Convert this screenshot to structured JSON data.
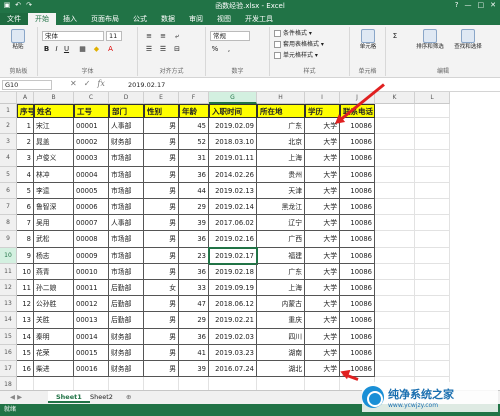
{
  "titlebar": {
    "title": "函数经验.xlsx - Excel",
    "qa_icons": [
      "save-icon",
      "undo-icon",
      "redo-icon"
    ],
    "window_controls": [
      "?",
      "—",
      "□",
      "✕"
    ]
  },
  "ribbon_tabs": [
    "文件",
    "开始",
    "插入",
    "页面布局",
    "公式",
    "数据",
    "审阅",
    "视图",
    "开发工具"
  ],
  "ribbon": {
    "clipboard": {
      "label": "剪贴板",
      "paste": "粘贴"
    },
    "font": {
      "label": "字体",
      "family": "宋体",
      "size": "11",
      "bold": "B",
      "italic": "I",
      "underline": "U"
    },
    "align": {
      "label": "对齐方式"
    },
    "number": {
      "label": "数字",
      "format": "常规",
      "percent": "%"
    },
    "styles": {
      "label": "样式",
      "items": [
        "条件格式 ▾",
        "套用表格格式 ▾",
        "单元格样式 ▾"
      ]
    },
    "cells": {
      "label": "单元格",
      "btn": "单元格"
    },
    "editing": {
      "label": "编辑",
      "sort": "排序和筛选",
      "find": "查找和选择"
    }
  },
  "formula_bar": {
    "name_box": "G10",
    "content": "2019.02.17"
  },
  "columns": [
    "A",
    "B",
    "C",
    "D",
    "E",
    "F",
    "G",
    "H",
    "I",
    "J",
    "K",
    "L"
  ],
  "selected_col": "G",
  "selected_row": 10,
  "table": {
    "headers": [
      "序号",
      "姓名",
      "工号",
      "部门",
      "性别",
      "年龄",
      "入职时间",
      "所在地",
      "学历",
      "联系电话"
    ],
    "rows": [
      [
        "1",
        "宋江",
        "00001",
        "人事部",
        "男",
        "45",
        "2019.02.09",
        "广东",
        "大学",
        "10086"
      ],
      [
        "2",
        "晁盖",
        "00002",
        "财务部",
        "男",
        "52",
        "2018.03.10",
        "北京",
        "大学",
        "10086"
      ],
      [
        "3",
        "卢俊义",
        "00003",
        "市场部",
        "男",
        "31",
        "2019.01.11",
        "上海",
        "大学",
        "10086"
      ],
      [
        "4",
        "林冲",
        "00004",
        "市场部",
        "男",
        "36",
        "2014.02.26",
        "贵州",
        "大学",
        "10086"
      ],
      [
        "5",
        "李逵",
        "00005",
        "市场部",
        "男",
        "44",
        "2019.02.13",
        "天津",
        "大学",
        "10086"
      ],
      [
        "6",
        "鲁智深",
        "00006",
        "市场部",
        "男",
        "29",
        "2019.02.14",
        "黑龙江",
        "大学",
        "10086"
      ],
      [
        "7",
        "吴用",
        "00007",
        "人事部",
        "男",
        "39",
        "2017.06.02",
        "辽宁",
        "大学",
        "10086"
      ],
      [
        "8",
        "武松",
        "00008",
        "市场部",
        "男",
        "36",
        "2019.02.16",
        "广西",
        "大学",
        "10086"
      ],
      [
        "9",
        "杨志",
        "00009",
        "市场部",
        "男",
        "23",
        "2019.02.17",
        "福建",
        "大学",
        "10086"
      ],
      [
        "10",
        "燕青",
        "00010",
        "市场部",
        "男",
        "36",
        "2019.02.18",
        "广东",
        "大学",
        "10086"
      ],
      [
        "11",
        "孙二娘",
        "00011",
        "后勤部",
        "女",
        "33",
        "2019.09.19",
        "上海",
        "大学",
        "10086"
      ],
      [
        "12",
        "公孙胜",
        "00012",
        "后勤部",
        "男",
        "47",
        "2018.06.12",
        "内蒙古",
        "大学",
        "10086"
      ],
      [
        "13",
        "关胜",
        "00013",
        "后勤部",
        "男",
        "29",
        "2019.02.21",
        "重庆",
        "大学",
        "10086"
      ],
      [
        "14",
        "秦明",
        "00014",
        "财务部",
        "男",
        "36",
        "2019.02.03",
        "四川",
        "大学",
        "10086"
      ],
      [
        "15",
        "花荣",
        "00015",
        "财务部",
        "男",
        "41",
        "2019.03.23",
        "湖南",
        "大学",
        "10086"
      ],
      [
        "16",
        "柴进",
        "00016",
        "财务部",
        "男",
        "39",
        "2016.07.24",
        "湖北",
        "大学",
        "10086"
      ]
    ]
  },
  "sheets": [
    "Sheet1",
    "Sheet2"
  ],
  "add_sheet": "⊕",
  "status": "就绪",
  "watermark": {
    "title": "纯净系统之家",
    "url": "www.ycwjzy.com"
  }
}
